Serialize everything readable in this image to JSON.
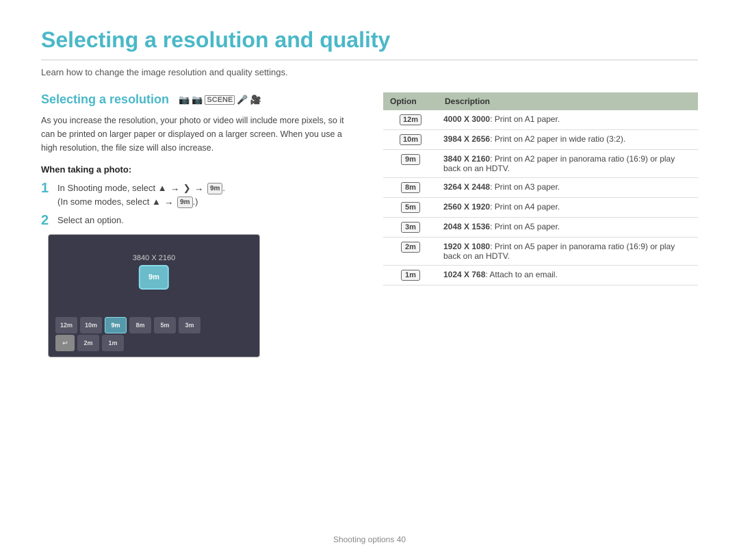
{
  "page": {
    "title": "Selecting a resolution and quality",
    "subtitle": "Learn how to change the image resolution and quality settings.",
    "footer": "Shooting options  40"
  },
  "left": {
    "section_title": "Selecting a resolution",
    "body": "As you increase the resolution, your photo or video will include more pixels, so it can be printed on larger paper or displayed on a larger screen. When you use a high resolution, the file size will also increase.",
    "when_taking_label": "When taking a photo:",
    "steps": [
      {
        "num": "1",
        "text": "In Shooting mode, select  → ❯ → ",
        "subtext": "(In some modes, select  → .)"
      },
      {
        "num": "2",
        "text": "Select an option."
      }
    ],
    "preview": {
      "resolution_text": "3840 X 2160",
      "selected_icon": "9m",
      "icons_row1": [
        "12m",
        "10m",
        "9m",
        "8m",
        "5m",
        "3m"
      ],
      "icons_row2": [
        "back",
        "2m",
        "1m"
      ]
    }
  },
  "right": {
    "table": {
      "headers": [
        "Option",
        "Description"
      ],
      "rows": [
        {
          "icon": "12m",
          "desc_bold": "4000 X 3000",
          "desc": ": Print on A1 paper."
        },
        {
          "icon": "10m",
          "desc_bold": "3984 X 2656",
          "desc": ": Print on A2 paper in wide ratio (3:2)."
        },
        {
          "icon": "9m",
          "desc_bold": "3840 X 2160",
          "desc": ": Print on A2 paper in panorama ratio (16:9) or play back on an HDTV."
        },
        {
          "icon": "8m",
          "desc_bold": "3264 X 2448",
          "desc": ": Print on A3 paper."
        },
        {
          "icon": "5m",
          "desc_bold": "2560 X 1920",
          "desc": ": Print on A4 paper."
        },
        {
          "icon": "3m",
          "desc_bold": "2048 X 1536",
          "desc": ": Print on A5 paper."
        },
        {
          "icon": "2m",
          "desc_bold": "1920 X 1080",
          "desc": ": Print on A5 paper in panorama ratio (16:9) or play back on an HDTV."
        },
        {
          "icon": "1m",
          "desc_bold": "1024 X 768",
          "desc": ": Attach to an email."
        }
      ]
    }
  }
}
